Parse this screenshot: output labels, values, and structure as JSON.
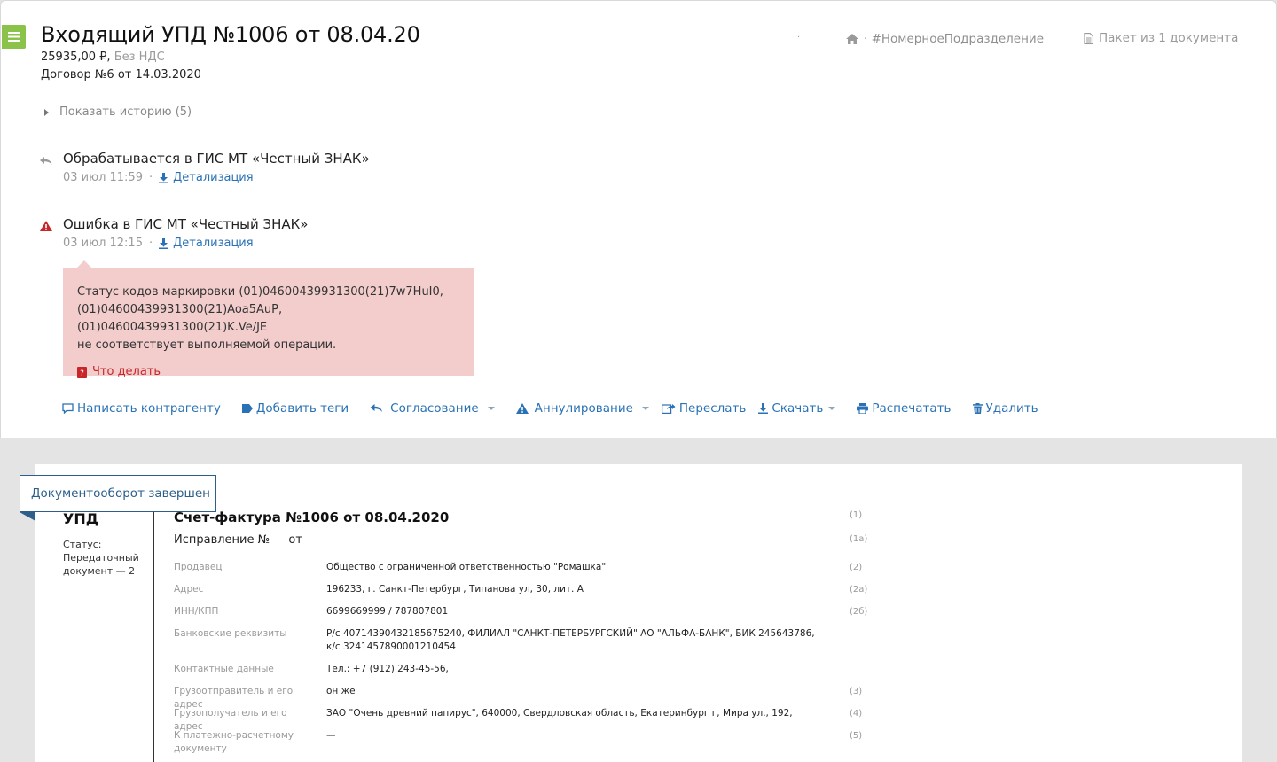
{
  "header": {
    "title": "Входящий УПД №1006 от 08.04.20",
    "amount": "25935,00 ₽,",
    "vat": "Без НДС",
    "contract": "Договор №6 от 14.03.2020",
    "dot": "·",
    "unit": "· #НомерноеПодразделение",
    "packet": "Пакет из 1 документа"
  },
  "history": {
    "label": "Показать историю (5)"
  },
  "events": [
    {
      "title": "Обрабатывается в ГИС МТ «Честный ЗНАК»",
      "time": "03 июл 11:59",
      "sep": "·",
      "link": "Детализация"
    },
    {
      "title": "Ошибка в ГИС МТ «Честный ЗНАК»",
      "time": "03 июл 12:15",
      "sep": "·",
      "link": "Детализация"
    }
  ],
  "error": {
    "line1": "Статус кодов маркировки (01)04600439931300(21)7w7HuI0,",
    "line2": "(01)04600439931300(21)Aoa5AuP, (01)04600439931300(21)K.Ve/JE",
    "line3": "не соответствует выполняемой операции.",
    "what": "Что делать"
  },
  "actions": {
    "write": "Написать контрагенту",
    "tags": "Добавить теги",
    "approve": "Согласование",
    "annul": "Аннулирование",
    "forward": "Переслать",
    "download": "Скачать",
    "print": "Распечатать",
    "delete": "Удалить"
  },
  "doc": {
    "badge": "Документооборот завершен",
    "upd": "УПД",
    "status_l1": "Статус:",
    "status_l2": "Передаточный",
    "status_l3": "документ — 2",
    "title": "Счет-фактура №1006 от 08.04.2020",
    "title_num": "(1)",
    "correction": "Исправление № — от —",
    "correction_num": "(1а)",
    "rows": [
      {
        "label": "Продавец",
        "value": "Общество с ограниченной ответственностью \"Ромашка\"",
        "num": "(2)"
      },
      {
        "label": "Адрес",
        "value": "196233, г. Санкт-Петербург, Типанова ул, 30, лит. А",
        "num": "(2а)"
      },
      {
        "label": "ИНН/КПП",
        "value": "6699669999 / 787807801",
        "num": "(2б)"
      },
      {
        "label": "Банковские реквизиты",
        "value": "Р/с 40714390432185675240, ФИЛИАЛ \"САНКТ-ПЕТЕРБУРГСКИЙ\" АО \"АЛЬФА-БАНК\", БИК 245643786, к/с 3241457890001210454",
        "num": ""
      },
      {
        "label": "Контактные данные",
        "value": "Тел.: +7 (912) 243-45-56,",
        "num": ""
      },
      {
        "label": "Грузоотправитель и его адрес",
        "value": "он же",
        "num": "(3)"
      },
      {
        "label": "Грузополучатель и его адрес",
        "value": "ЗАО \"Очень древний папирус\", 640000, Свердловская область, Екатеринбург г, Мира ул., 192,",
        "num": "(4)"
      },
      {
        "label": "К платежно-расчетному документу",
        "value": "—",
        "num": "(5)"
      }
    ]
  },
  "colors": {
    "accent": "#2a72b5",
    "menu": "#8bc34a",
    "error_bg": "#f3cccc",
    "error_text": "#c7272a",
    "badge": "#2d5f8a"
  }
}
